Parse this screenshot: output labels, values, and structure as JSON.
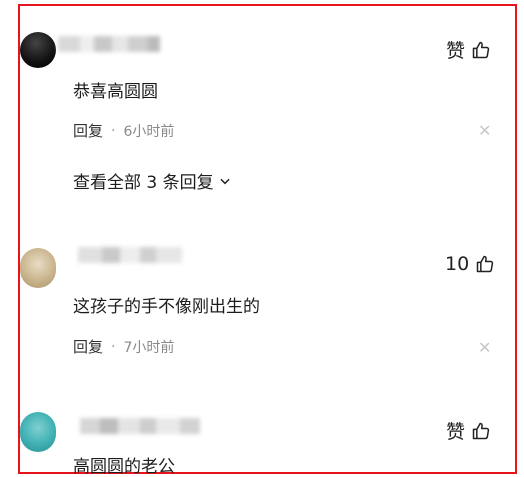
{
  "comments": [
    {
      "text": "恭喜高圆圆",
      "like_label": "赞",
      "reply_label": "回复",
      "time": "6小时前",
      "expand_label": "查看全部 3 条回复"
    },
    {
      "text": "这孩子的手不像刚出生的",
      "like_label": "10",
      "reply_label": "回复",
      "time": "7小时前"
    },
    {
      "text": "高圆圆的老公",
      "like_label": "赞"
    }
  ],
  "separator": "·",
  "colors": {
    "highlight_border": "#e8141c",
    "time_text": "#8a8a8a",
    "close_icon": "#c8c8c8"
  }
}
